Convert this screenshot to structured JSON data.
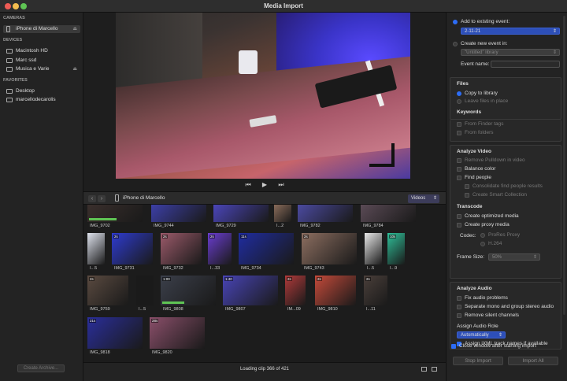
{
  "window": {
    "title": "Media Import"
  },
  "sidebar": {
    "cameras_header": "CAMERAS",
    "camera_items": [
      {
        "label": "iPhone di Marcello"
      }
    ],
    "devices_header": "DEVICES",
    "device_items": [
      {
        "label": "Macintosh HD"
      },
      {
        "label": "Marc ssd"
      },
      {
        "label": "Musica e Varie"
      }
    ],
    "favorites_header": "FAVORITES",
    "favorite_items": [
      {
        "label": "Desktop"
      },
      {
        "label": "marcellodecarolis"
      }
    ],
    "create_archive_label": "Create Archive..."
  },
  "player": {
    "prev_icon": "skip-back",
    "play_icon": "play",
    "next_icon": "skip-forward"
  },
  "browser": {
    "device_label": "iPhone di Marcello",
    "filter_value": "Videos",
    "clips": [
      {
        "label": "IMG_9702",
        "duration": "",
        "color": "#3a2f2c",
        "progress": 0.5
      },
      {
        "label": "IMG_9744",
        "duration": "",
        "color": "#3c3fa6",
        "progress": 0
      },
      {
        "label": "IMG_9729",
        "duration": "",
        "color": "#4a45b8",
        "progress": 0
      },
      {
        "label": "I...2",
        "duration": "",
        "color": "#8a6c5a",
        "progress": 0
      },
      {
        "label": "IMG_9782",
        "duration": "",
        "color": "#4b4aa0",
        "progress": 0
      },
      {
        "label": "IMG_9784",
        "duration": "",
        "color": "#5a4a55",
        "progress": 0
      },
      {
        "label": "I...5",
        "duration": "",
        "color": "#dfe3ee",
        "progress": 0
      },
      {
        "label": "IMG_9731",
        "duration": "2s",
        "color": "#2e3bd0",
        "progress": 0
      },
      {
        "label": "IMG_9732",
        "duration": "2s",
        "color": "#9b5a6a",
        "progress": 0
      },
      {
        "label": "I...33",
        "duration": "2s",
        "color": "#6a3dd0",
        "progress": 0
      },
      {
        "label": "IMG_9734",
        "duration": "11s",
        "color": "#1f2ca0",
        "progress": 0
      },
      {
        "label": "IMG_9743",
        "duration": "2s",
        "color": "#8c6e60",
        "progress": 0
      },
      {
        "label": "I...5",
        "duration": "",
        "color": "#e8e8e8",
        "progress": 0
      },
      {
        "label": "I...9",
        "duration": "10s",
        "color": "#2fc19a",
        "progress": 0
      },
      {
        "label": "IMG_9759",
        "duration": "2s",
        "color": "#5a4a40",
        "progress": 0
      },
      {
        "label": "I...5",
        "duration": "",
        "color": "#1a1a1a",
        "progress": 0
      },
      {
        "label": "IMG_9808",
        "duration": "1:00",
        "color": "#3b3f4a",
        "progress": 0.4
      },
      {
        "label": "IMG_9807",
        "duration": "1:40",
        "color": "#4844b5",
        "progress": 0
      },
      {
        "label": "IM...09",
        "duration": "2s",
        "color": "#b03a3a",
        "progress": 0
      },
      {
        "label": "IMG_9810",
        "duration": "2s",
        "color": "#c44a3a",
        "progress": 0
      },
      {
        "label": "I...11",
        "duration": "2s",
        "color": "#4a3f3a",
        "progress": 0
      },
      {
        "label": "IMG_9818",
        "duration": "21s",
        "color": "#2a2e9a",
        "progress": 0
      },
      {
        "label": "IMG_9820",
        "duration": "28s",
        "color": "#8a4f6a",
        "progress": 0
      }
    ],
    "status": "Loading clip 366 of 421"
  },
  "options": {
    "add_existing_label": "Add to existing event:",
    "existing_event_value": "2-11-21",
    "create_new_label": "Create new event in:",
    "library_value": "\"Untitled\" library",
    "event_name_label": "Event name:",
    "files_header": "Files",
    "copy_label": "Copy to library",
    "leave_label": "Leave files in place",
    "keywords_header": "Keywords",
    "finder_tags_label": "From Finder tags",
    "folders_label": "From folders",
    "analyze_video_header": "Analyze Video",
    "pulldown_label": "Remove Pulldown in video",
    "balance_label": "Balance color",
    "find_people_label": "Find people",
    "consolidate_label": "Consolidate find people results",
    "smart_collection_label": "Create Smart Collection",
    "transcode_header": "Transcode",
    "optimized_label": "Create optimized media",
    "proxy_label": "Create proxy media",
    "codec_label": "Codec:",
    "codec_prores": "ProRes Proxy",
    "codec_h264": "H.264",
    "frame_size_label": "Frame Size:",
    "frame_size_value": "50%",
    "analyze_audio_header": "Analyze Audio",
    "fix_audio_label": "Fix audio problems",
    "separate_label": "Separate mono and group stereo audio",
    "silent_label": "Remove silent channels",
    "role_label": "Assign Audio Role",
    "role_value": "Automatically",
    "ixml_label": "Assign iXML track names if available",
    "close_window_label": "Close window after starting import",
    "stop_import_label": "Stop Import",
    "import_all_label": "Import All"
  },
  "colors": {
    "accent": "#2d6df6",
    "close": "#ee5b55",
    "minimize": "#f4bd4f",
    "zoom": "#5fc454"
  }
}
